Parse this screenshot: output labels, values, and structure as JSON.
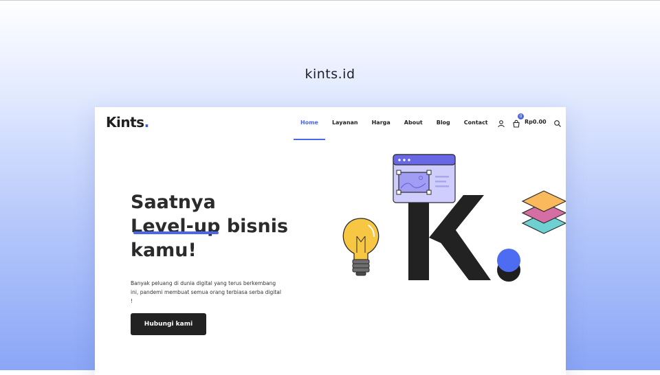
{
  "page_title": "kints.id",
  "header": {
    "logo_text": "Kints",
    "logo_dot": ".",
    "nav": [
      {
        "label": "Home",
        "active": true
      },
      {
        "label": "Layanan",
        "active": false
      },
      {
        "label": "Harga",
        "active": false
      },
      {
        "label": "About",
        "active": false
      },
      {
        "label": "Blog",
        "active": false
      },
      {
        "label": "Contact",
        "active": false
      }
    ],
    "cart_count": "0",
    "cart_total": "Rp0.00",
    "icons": [
      "user-icon",
      "cart-icon",
      "search-icon"
    ]
  },
  "hero": {
    "title_line1": "Saatnya",
    "title_word_highlight": "Level-up",
    "title_line2_rest": " bisnis",
    "title_line3": "kamu!",
    "description": "Banyak peluang di dunia digital yang terus berkembang ini, pandemi membuat semua orang terbiasa serba digital !",
    "cta_label": "Hubungi kami"
  },
  "colors": {
    "accent": "#4b67e8",
    "dark": "#222222",
    "bulb": "#f7c744",
    "layer_orange": "#f9b95c",
    "layer_pink": "#d46ea3",
    "layer_teal": "#6fd0d2",
    "window_bg": "#c9c8fb"
  }
}
